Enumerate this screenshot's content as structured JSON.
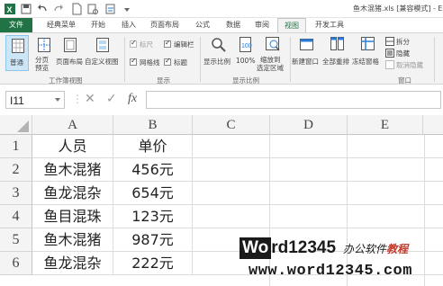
{
  "window": {
    "title": "鱼木混猪.xls [兼容模式] - Ex"
  },
  "tabs": [
    {
      "label": "文件"
    },
    {
      "label": "经典菜单"
    },
    {
      "label": "开始"
    },
    {
      "label": "插入"
    },
    {
      "label": "页面布局"
    },
    {
      "label": "公式"
    },
    {
      "label": "数据"
    },
    {
      "label": "审阅"
    },
    {
      "label": "视图"
    },
    {
      "label": "开发工具"
    }
  ],
  "active_tab": "视图",
  "ribbon": {
    "workbook_views": {
      "normal": "普通",
      "page_break_line1": "分页",
      "page_break_line2": "预览",
      "page_layout": "页面布局",
      "custom_views": "自定义视图",
      "group_label": "工作簿视图"
    },
    "show": {
      "ruler": "标尺",
      "formula_bar": "编辑栏",
      "gridlines": "网格线",
      "headings": "标题",
      "ruler_checked": true,
      "formula_bar_checked": true,
      "gridlines_checked": true,
      "headings_checked": true,
      "group_label": "显示"
    },
    "zoom": {
      "zoom": "显示比例",
      "hundred": "100%",
      "zoom_sel_line1": "缩放到",
      "zoom_sel_line2": "选定区域",
      "group_label": "显示比例"
    },
    "window": {
      "new_window": "新建窗口",
      "arrange_all": "全部重排",
      "freeze_panes": "冻结窗格",
      "split": "拆分",
      "hide": "隐藏",
      "unhide": "取消隐藏",
      "group_label": "窗口"
    }
  },
  "formula_bar": {
    "name_box": "I11",
    "cancel_icon": "✕",
    "enter_icon": "✓",
    "fx": "fx",
    "content": ""
  },
  "sheet": {
    "columns": [
      "A",
      "B",
      "C",
      "D",
      "E"
    ],
    "rows": [
      {
        "num": "1",
        "a": "人员",
        "b": "单价"
      },
      {
        "num": "2",
        "a": "鱼木混猪",
        "b": "456元"
      },
      {
        "num": "3",
        "a": "鱼龙混杂",
        "b": "654元"
      },
      {
        "num": "4",
        "a": "鱼目混珠",
        "b": "123元"
      },
      {
        "num": "5",
        "a": "鱼木混猪",
        "b": "987元"
      },
      {
        "num": "6",
        "a": "鱼龙混杂",
        "b": "222元"
      }
    ]
  },
  "watermark": {
    "brand_box": "Wo",
    "brand_rest": "rd12345",
    "tagline_part1": "办公软件",
    "tagline_part2": "教程",
    "url": "www.word12345.com"
  },
  "colors": {
    "excel_green": "#217346",
    "ribbon_bg": "#f3f3f3",
    "header_bg": "#f4f4f4",
    "grid_line": "#dcdcdc",
    "watermark_red": "#c0392b"
  }
}
